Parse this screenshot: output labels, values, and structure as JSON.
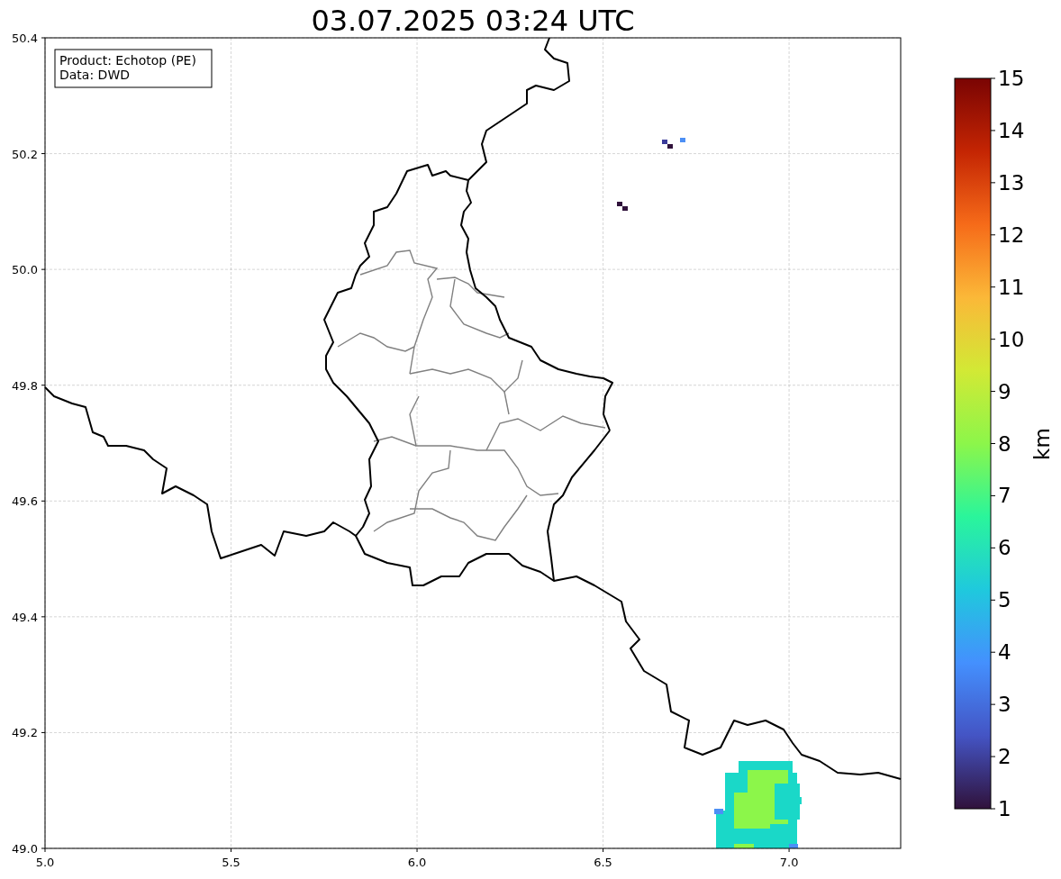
{
  "title": "03.07.2025 03:24 UTC",
  "legend": [
    "Product: Echotop (PE)",
    "Data: DWD"
  ],
  "x_ticks": [
    "5.0",
    "5.5",
    "6.0",
    "6.5",
    "7.0"
  ],
  "y_ticks": [
    "50.4",
    "50.2",
    "50.0",
    "49.8",
    "49.6",
    "49.4",
    "49.2",
    "49.0"
  ],
  "colorbar": {
    "label": "km",
    "ticks": [
      "15",
      "14",
      "13",
      "12",
      "11",
      "10",
      "9",
      "8",
      "7",
      "6",
      "5",
      "4",
      "3",
      "2",
      "1"
    ]
  }
}
